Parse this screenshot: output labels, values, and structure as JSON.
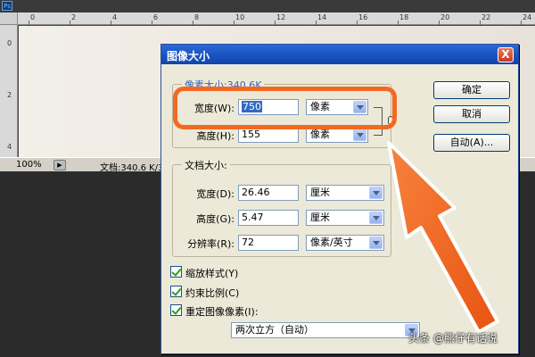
{
  "photoshop": {
    "logo": "Ps",
    "ruler_top_ticks": [
      "0",
      "2",
      "4",
      "6",
      "8",
      "10",
      "12",
      "14",
      "16",
      "18",
      "20",
      "22",
      "24"
    ],
    "ruler_left_ticks": [
      "0",
      "2",
      "4"
    ],
    "status": {
      "zoom": "100%",
      "doc_info": "文档:340.6 K/3"
    }
  },
  "dialog": {
    "title": "图像大小",
    "close_label": "X",
    "pixel_dimensions": {
      "legend": "像素大小:340.6K",
      "width": {
        "label": "宽度(W):",
        "value": "750",
        "unit": "像素"
      },
      "height": {
        "label": "高度(H):",
        "value": "155",
        "unit": "像素"
      }
    },
    "document_size": {
      "legend": "文档大小:",
      "width": {
        "label": "宽度(D):",
        "value": "26.46",
        "unit": "厘米"
      },
      "height": {
        "label": "高度(G):",
        "value": "5.47",
        "unit": "厘米"
      },
      "resolution": {
        "label": "分辨率(R):",
        "value": "72",
        "unit": "像素/英寸"
      }
    },
    "buttons": {
      "ok": "确定",
      "cancel": "取消",
      "auto": "自动(A)..."
    },
    "checkboxes": [
      {
        "label": "缩放样式(Y)",
        "checked": true
      },
      {
        "label": "约束比例(C)",
        "checked": true
      },
      {
        "label": "重定图像像素(I):",
        "checked": true
      }
    ],
    "resample_method": "两次立方（自动）"
  },
  "annotation": {
    "color": "#f26a21"
  },
  "watermark": "头条 @熊仔有话说"
}
